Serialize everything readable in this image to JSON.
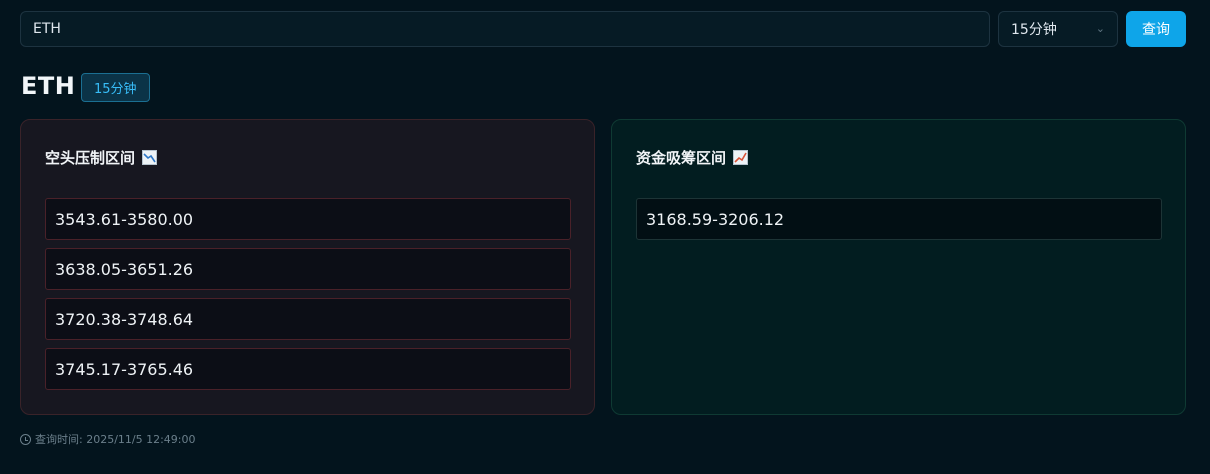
{
  "search": {
    "value": "ETH"
  },
  "interval_select": {
    "selected": "15分钟"
  },
  "query_button": {
    "label": "查询"
  },
  "header": {
    "symbol": "ETH",
    "interval_badge": "15分钟"
  },
  "short_panel": {
    "title": "空头压制区间",
    "icon": "chart-decreasing-icon",
    "ranges": [
      "3543.61-3580.00",
      "3638.05-3651.26",
      "3720.38-3748.64",
      "3745.17-3765.46"
    ]
  },
  "long_panel": {
    "title": "资金吸筹区间",
    "icon": "chart-increasing-icon",
    "ranges": [
      "3168.59-3206.12"
    ]
  },
  "footer": {
    "query_time": "查询时间: 2025/11/5 12:49:00"
  },
  "colors": {
    "accent": "#0ea5e9",
    "short_border": "#4a2129",
    "long_bg": "#021d20"
  }
}
